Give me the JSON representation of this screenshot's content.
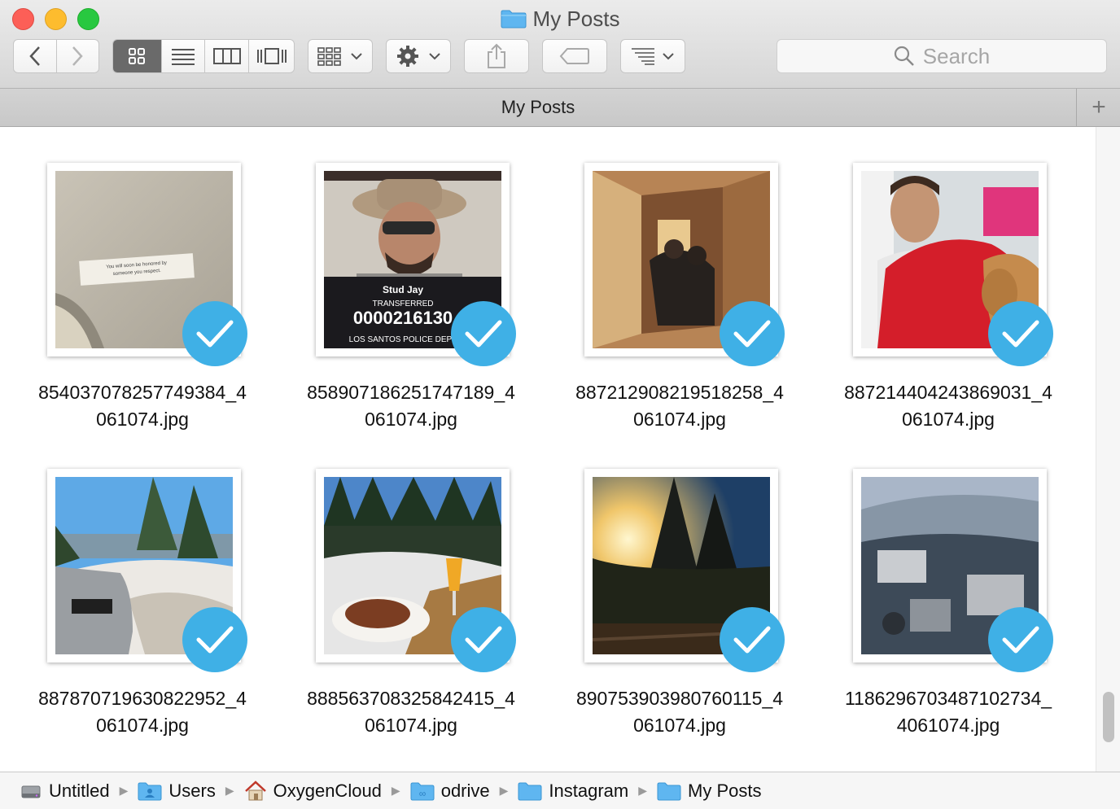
{
  "window": {
    "title": "My Posts"
  },
  "toolbar": {
    "back_icon": "chevron-left-icon",
    "forward_icon": "chevron-right-icon",
    "views": [
      "icon-view",
      "list-view",
      "column-view",
      "cover-flow-view"
    ],
    "active_view": "icon-view",
    "search_placeholder": "Search"
  },
  "tabbar": {
    "title": "My Posts",
    "add_label": "+"
  },
  "files": [
    {
      "name": "854037078257749384_4061074.jpg",
      "line1": "854037078257749384_4",
      "line2": "061074.jpg",
      "synced": true,
      "scene": "paper"
    },
    {
      "name": "858907186251747189_4061074.jpg",
      "line1": "858907186251747189_4",
      "line2": "061074.jpg",
      "synced": true,
      "scene": "mugshot",
      "mug_name": "Stud Jay",
      "mug_status": "TRANSFERRED",
      "mug_number": "0000216130",
      "mug_dept": "LOS SANTOS POLICE DEPT"
    },
    {
      "name": "887212908219518258_4061074.jpg",
      "line1": "887212908219518258_4",
      "line2": "061074.jpg",
      "synced": true,
      "scene": "hallway"
    },
    {
      "name": "887214404243869031_4061074.jpg",
      "line1": "887214404243869031_4",
      "line2": "061074.jpg",
      "synced": true,
      "scene": "dog"
    },
    {
      "name": "887870719630822952_4061074.jpg",
      "line1": "887870719630822952_4",
      "line2": "061074.jpg",
      "synced": true,
      "scene": "car-snow"
    },
    {
      "name": "888563708325842415_4061074.jpg",
      "line1": "888563708325842415_4",
      "line2": "061074.jpg",
      "synced": true,
      "scene": "breakfast"
    },
    {
      "name": "890753903980760115_4061074.jpg",
      "line1": "890753903980760115_4",
      "line2": "061074.jpg",
      "synced": true,
      "scene": "sunset"
    },
    {
      "name": "1186296703487102734_4061074.jpg",
      "line1": "1186296703487102734_",
      "line2": "4061074.jpg",
      "synced": true,
      "scene": "village"
    }
  ],
  "paper_note": {
    "line1": "You will soon be honored by",
    "line2": "someone you respect."
  },
  "breadcrumb": [
    {
      "label": "Untitled",
      "icon": "hard-drive-icon"
    },
    {
      "label": "Users",
      "icon": "users-folder-icon"
    },
    {
      "label": "OxygenCloud",
      "icon": "home-icon"
    },
    {
      "label": "odrive",
      "icon": "odrive-folder-icon"
    },
    {
      "label": "Instagram",
      "icon": "folder-icon"
    },
    {
      "label": "My Posts",
      "icon": "folder-icon"
    }
  ],
  "colors": {
    "check": "#3fb0e6",
    "folder": "#5fb6f0"
  }
}
